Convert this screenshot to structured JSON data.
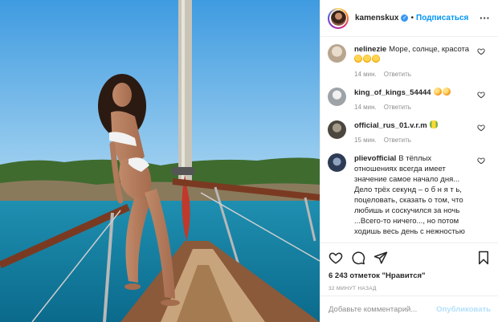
{
  "post": {
    "username": "kamenskux",
    "separator": "•",
    "follow_label": "Подписаться",
    "more_label": "···",
    "photo_alt": "Фото"
  },
  "comments": [
    {
      "user": "nelinezie",
      "text": "Море, солнце, красота",
      "emojis": [
        "heart-eyes",
        "heart-eyes",
        "heart-eyes"
      ],
      "time": "14 мин.",
      "reply": "Ответить",
      "avatar_color": "#d8cfc4"
    },
    {
      "user": "king_of_kings_54444",
      "text": "",
      "emojis": [
        "mango",
        "mango"
      ],
      "time": "14 мин.",
      "reply": "Ответить",
      "avatar_color": "#bfc4c9"
    },
    {
      "user": "official_rus_01.v.r.m",
      "text": "",
      "emojis": [
        "corn"
      ],
      "time": "15 мин.",
      "reply": "Ответить",
      "avatar_color": "#6f6a5e"
    },
    {
      "user": "plievofficial",
      "text": "В тёплых отношениях всегда имеет значение самое начало дня... Дело трёх секунд – о б н я т ь, поцеловать, сказать о том, что любишь и соскучился за ночь ...Всего-то ничего..., но потом ходишь весь день с нежностью",
      "emojis": [],
      "time": "",
      "reply": "",
      "avatar_color": "#3a4a66"
    }
  ],
  "actions": {
    "likes": "6 243 отметок \"Нравится\"",
    "time_ago": "32 МИНУТ НАЗАД"
  },
  "composer": {
    "placeholder": "Добавьте комментарий...",
    "publish_label": "Опубликовать"
  },
  "colors": {
    "accent": "#0095f6",
    "publish_disabled": "#b2dffc",
    "muted": "#8e8e8e"
  }
}
